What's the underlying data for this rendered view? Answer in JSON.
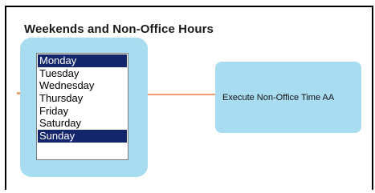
{
  "section": {
    "title": "Weekends and Non-Office Hours"
  },
  "day_selector": {
    "days": [
      {
        "label": "Monday",
        "selected": true
      },
      {
        "label": "Tuesday",
        "selected": false
      },
      {
        "label": "Wednesday",
        "selected": false
      },
      {
        "label": "Thursday",
        "selected": false
      },
      {
        "label": "Friday",
        "selected": false
      },
      {
        "label": "Saturday",
        "selected": false
      },
      {
        "label": "Sunday",
        "selected": true
      }
    ]
  },
  "action": {
    "label": "Execute Non-Office Time AA"
  },
  "colors": {
    "node_fill": "#a8dcf1",
    "selection": "#14266b",
    "connector": "#f0a070"
  }
}
